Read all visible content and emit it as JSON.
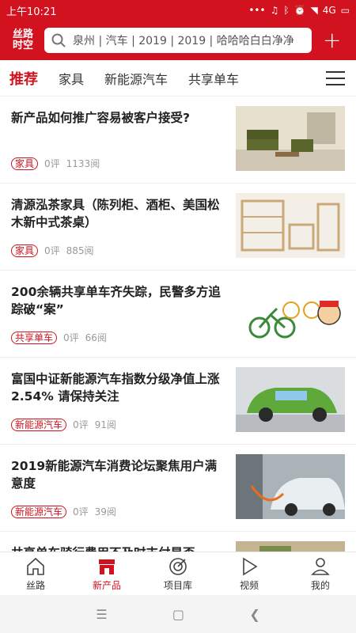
{
  "status": {
    "time": "上午10:21",
    "network": "4G"
  },
  "header": {
    "logo_top": "丝路",
    "logo_bottom": "时空",
    "search_placeholder": "泉州 | 汽车 | 2019 | 2019 | 哈哈哈白白净净",
    "plus": "+"
  },
  "tabs": [
    {
      "label": "推荐"
    },
    {
      "label": "家具"
    },
    {
      "label": "新能源汽车"
    },
    {
      "label": "共享单车"
    }
  ],
  "feed": [
    {
      "title": "新产品如何推广容易被客户接受?",
      "tag": "家具",
      "comments": "0评",
      "reads": "1133阅"
    },
    {
      "title": "清源泓茶家具（陈列柜、酒柜、美国松木新中式茶桌）",
      "tag": "家具",
      "comments": "0评",
      "reads": "885阅"
    },
    {
      "title": "200余辆共享单车齐失踪，民警多方追踪破“案”",
      "tag": "共享单车",
      "comments": "0评",
      "reads": "66阅"
    },
    {
      "title": "富国中证新能源汽车指数分级净值上涨2.54% 请保持关注",
      "tag": "新能源汽车",
      "comments": "0评",
      "reads": "91阅"
    },
    {
      "title": "2019新能源汽车消费论坛聚焦用户满意度",
      "tag": "新能源汽车",
      "comments": "0评",
      "reads": "39阅"
    },
    {
      "title": "共享单车骑行费用不及时支付是否",
      "tag": "",
      "comments": "",
      "reads": ""
    }
  ],
  "nav": [
    {
      "label": "丝路"
    },
    {
      "label": "新产品"
    },
    {
      "label": "项目库"
    },
    {
      "label": "视频"
    },
    {
      "label": "我的"
    }
  ],
  "colors": {
    "brand": "#d2121f"
  }
}
